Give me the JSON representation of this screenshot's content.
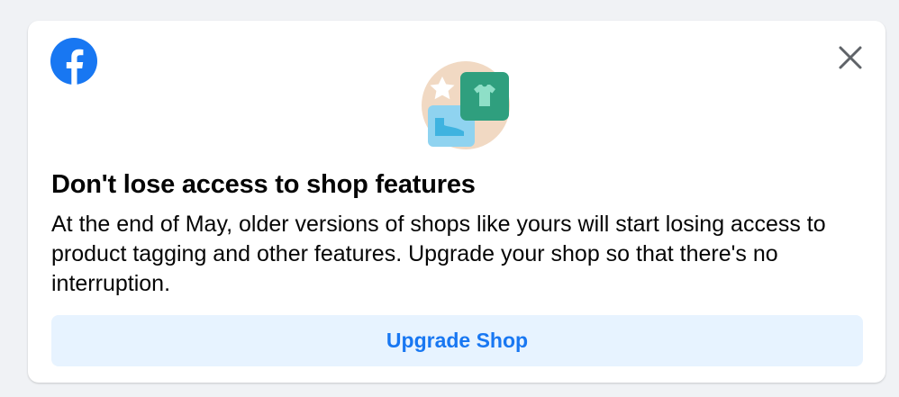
{
  "notification": {
    "title": "Don't lose access to shop features",
    "body": "At the end of May, older versions of shops like yours will start losing access to product tagging and other features. Upgrade your shop so that there's no interruption.",
    "primary_action_label": "Upgrade Shop",
    "icons": {
      "brand": "facebook-logo-icon",
      "close": "close-icon",
      "illustration": "shop-illustration-icon"
    },
    "colors": {
      "brand_blue": "#1877f2",
      "button_bg": "#e7f3ff",
      "title_text": "#050505",
      "illustration_circle": "#f1d9c3",
      "tshirt_card": "#2f9f7e",
      "shoe_card": "#8fd3f0"
    }
  }
}
